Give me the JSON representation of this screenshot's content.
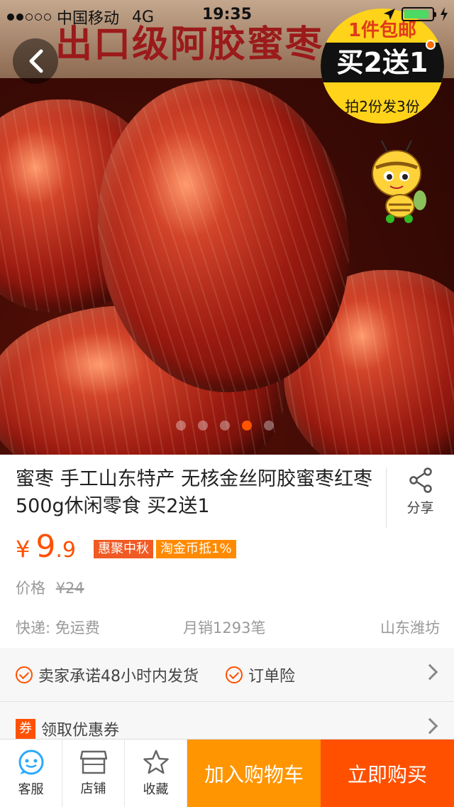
{
  "status_bar": {
    "carrier": "中国移动",
    "network": "4G",
    "time": "19:35",
    "signal_bars": 2,
    "battery_level": 0.9
  },
  "hero": {
    "banner_text": "出口级阿胶蜜枣",
    "promo_badge": {
      "line1": "1件包邮",
      "line2": "买2送1",
      "line3": "拍2份发3份"
    },
    "pager": {
      "count": 5,
      "active_index": 3
    }
  },
  "product": {
    "title": "蜜枣 手工山东特产 无核金丝阿胶蜜枣红枣500g休闲零食 买2送1",
    "share_label": "分享",
    "currency_symbol": "¥",
    "price_integer": "9",
    "price_decimal": ".9",
    "tags": [
      "惠聚中秋",
      "淘金币抵1%"
    ],
    "original_price_label": "价格",
    "original_price": "¥24",
    "shipping": "快递: 免运费",
    "monthly_sales": "月销1293笔",
    "location": "山东潍坊"
  },
  "guarantee": {
    "promise": "卖家承诺48小时内发货",
    "insurance": "订单险",
    "coupon_icon_text": "券",
    "coupon_label": "领取优惠券"
  },
  "bottom_bar": {
    "service_label": "客服",
    "shop_label": "店铺",
    "favorite_label": "收藏",
    "add_to_cart_label": "加入购物车",
    "buy_now_label": "立即购买"
  },
  "colors": {
    "accent": "#ff5000",
    "cart_button": "#ff9500",
    "service_icon": "#2aa9ff",
    "tag_a": "#f05a24",
    "tag_b": "#ff8a00"
  }
}
